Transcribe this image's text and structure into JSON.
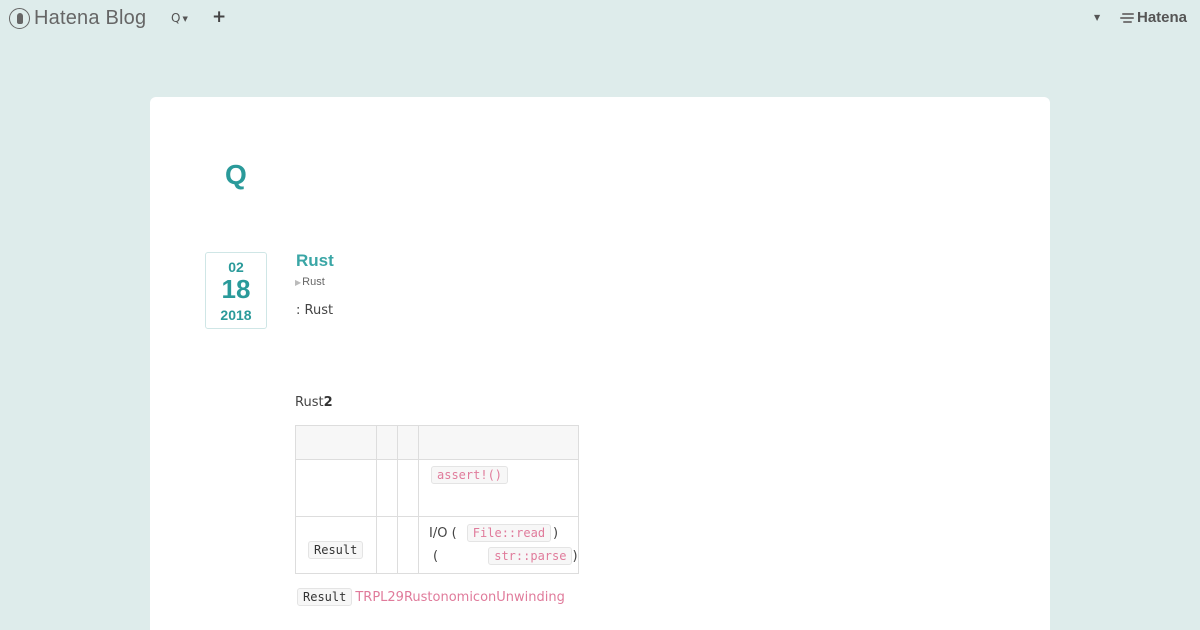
{
  "header": {
    "logo_text": "Hatena Blog",
    "search_menu_label": "Q",
    "add_label": "+",
    "hatena_label": "Hatena"
  },
  "blog": {
    "title": "Q"
  },
  "entry": {
    "date": {
      "month": "02",
      "day": "18",
      "year": "2018"
    },
    "title": "Rust",
    "category": "Rust",
    "meta_line": ": Rust",
    "lead_prefix": "Rust",
    "lead_bold": "2"
  },
  "table": {
    "headers": [
      "",
      "",
      "",
      ""
    ],
    "rows": [
      {
        "c1": "",
        "c2": "",
        "c3": "",
        "c4_code": "assert!()"
      },
      {
        "c1_code": "Result",
        "c2": "",
        "c3": "",
        "c4_line1_text": "I/O (",
        "c4_line1_code": "File::read",
        "c4_line1_end": ")",
        "c4_line2_text": "(",
        "c4_line2_code": "str::parse",
        "c4_line2_end": ")"
      }
    ]
  },
  "footer_line": {
    "code": "Result",
    "link": "TRPL29RustonomiconUnwinding"
  },
  "colors": {
    "page_background": "#deeceb",
    "accent_teal": "#2a9a9a",
    "code_pink": "#e07b9b"
  }
}
